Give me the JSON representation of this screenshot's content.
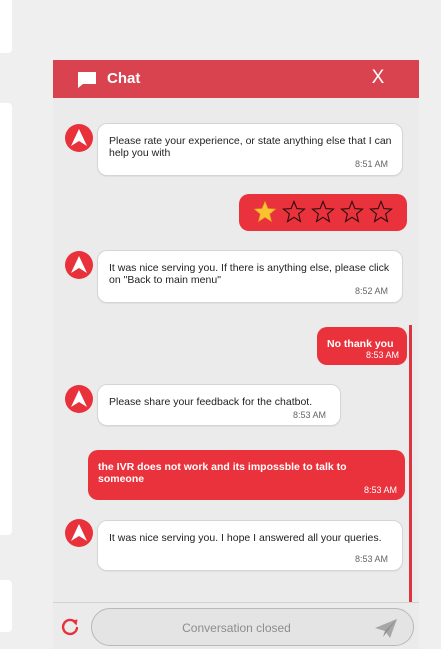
{
  "colors": {
    "header": "#d9434f",
    "accent": "#ea323c",
    "background": "#ebebeb"
  },
  "header": {
    "title": "Chat",
    "icon": "chat-bubble-icon",
    "close_label": "X"
  },
  "rating": {
    "filled": 1,
    "total": 5
  },
  "messages": [
    {
      "from": "bot",
      "text": "Please rate your experience, or state anything else that I can help you with",
      "time": "8:51 AM"
    },
    {
      "from": "user",
      "type": "rating",
      "stars": 1,
      "max": 5
    },
    {
      "from": "bot",
      "text": "It was nice serving you. If there is anything else, please click on \"Back to main menu\"",
      "time": "8:52 AM"
    },
    {
      "from": "user",
      "text": "No thank you",
      "time": "8:53 AM"
    },
    {
      "from": "bot",
      "text": "Please share your feedback for the chatbot.",
      "time": "8:53 AM"
    },
    {
      "from": "user",
      "text": "the IVR does not work and its impossble to talk to someone",
      "time": "8:53 AM"
    },
    {
      "from": "bot",
      "text": "It was nice serving you. I hope I answered all your queries.",
      "time": "8:53 AM"
    }
  ],
  "footer": {
    "placeholder": "Conversation closed",
    "restart_icon": "restart-icon",
    "send_icon": "send-icon"
  }
}
